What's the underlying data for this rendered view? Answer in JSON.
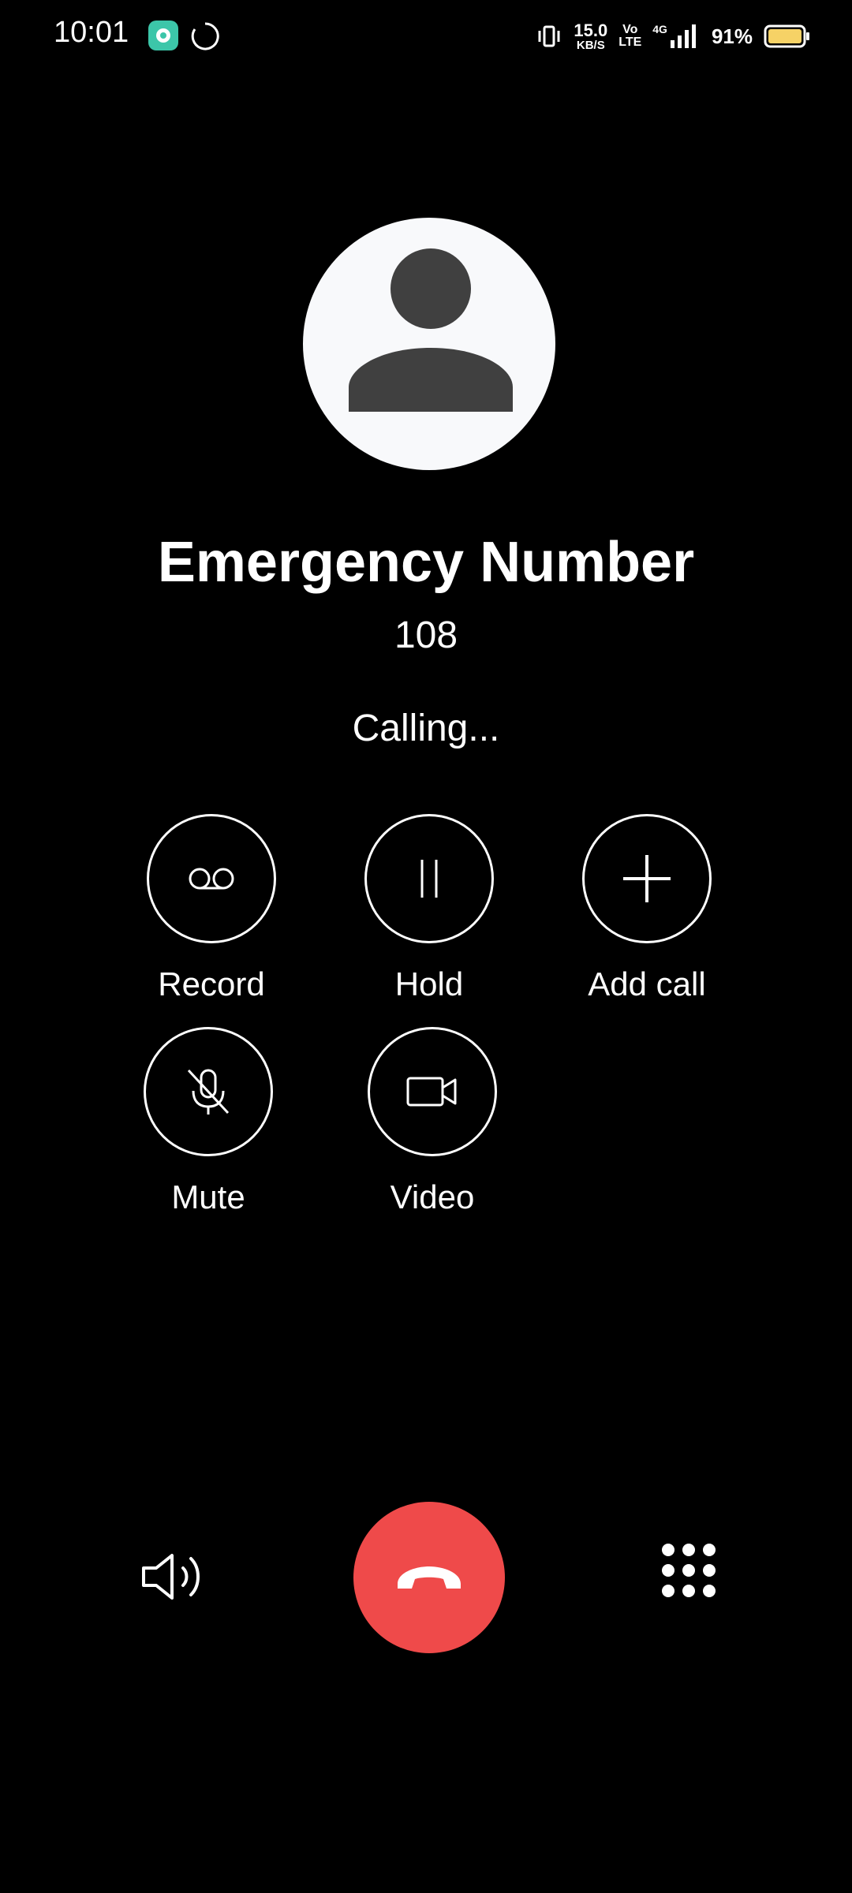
{
  "status_bar": {
    "time": "10:01",
    "speed_value": "15.0",
    "speed_unit": "KB/S",
    "volte_top": "Vo",
    "volte_bottom": "LTE",
    "network": "4G",
    "battery": "91%"
  },
  "caller": {
    "name": "Emergency Number",
    "number": "108",
    "status": "Calling..."
  },
  "controls": {
    "record": "Record",
    "hold": "Hold",
    "add_call": "Add call",
    "mute": "Mute",
    "video": "Video"
  },
  "colors": {
    "background": "#000000",
    "end_call": "#ef4a4a",
    "avatar_bg": "#f8f9fb",
    "avatar_fg": "#404040",
    "battery": "#f6d266"
  }
}
